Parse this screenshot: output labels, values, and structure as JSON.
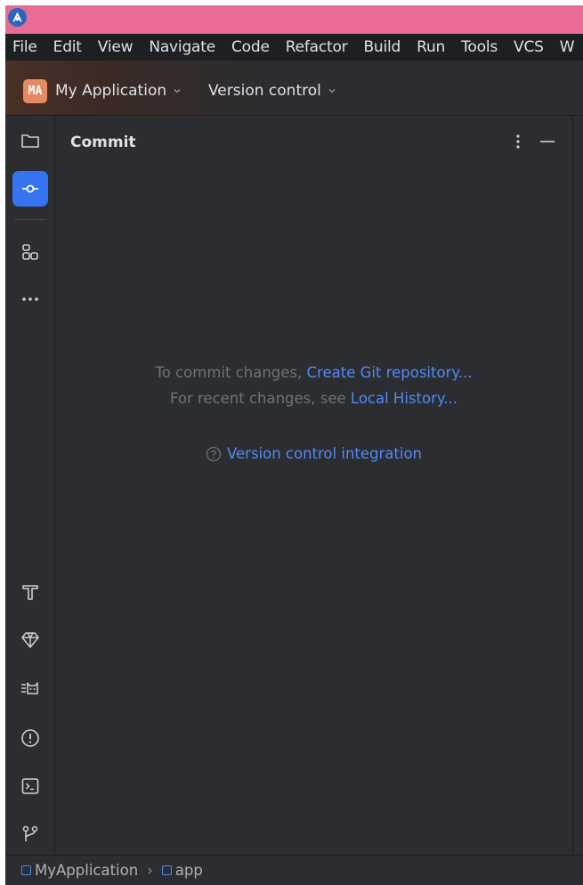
{
  "menu": [
    "File",
    "Edit",
    "View",
    "Navigate",
    "Code",
    "Refactor",
    "Build",
    "Run",
    "Tools",
    "VCS",
    "W"
  ],
  "toolbar": {
    "project_initials": "MA",
    "project_name": "My Application",
    "version_control_label": "Version control"
  },
  "commit_panel": {
    "title": "Commit",
    "line1_text": "To commit changes,",
    "line1_link": "Create Git repository...",
    "line2_text": "For recent changes, see",
    "line2_link": "Local History...",
    "help_link": "Version control integration"
  },
  "statusbar": {
    "crumbs": [
      "MyApplication",
      "app"
    ]
  },
  "colors": {
    "title_bar": "#e86b94",
    "accent": "#3574f0",
    "link": "#548af7",
    "panel_bg": "#2b2d30",
    "project_badge": "#e58a63"
  },
  "icons": {
    "left_strip_top": [
      "folder-icon",
      "commit-icon",
      "structure-icon",
      "more-icon"
    ],
    "left_strip_bottom": [
      "build-icon",
      "gem-icon",
      "logcat-icon",
      "problems-icon",
      "terminal-icon",
      "git-branch-icon"
    ]
  }
}
